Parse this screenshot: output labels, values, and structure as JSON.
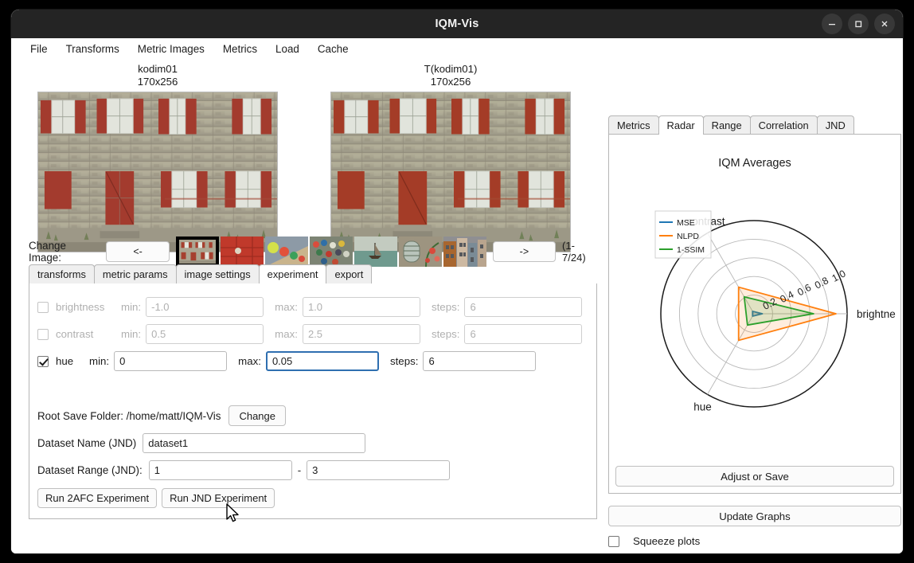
{
  "window": {
    "title": "IQM-Vis",
    "controls": [
      {
        "name": "minimize",
        "glyph": "minimize-icon"
      },
      {
        "name": "maximize",
        "glyph": "maximize-icon"
      },
      {
        "name": "close",
        "glyph": "close-icon"
      }
    ]
  },
  "menubar": {
    "items": [
      "File",
      "Transforms",
      "Metric Images",
      "Metrics",
      "Load",
      "Cache"
    ]
  },
  "images": {
    "source": {
      "name": "kodim01",
      "size": "170x256"
    },
    "transformed": {
      "name": "T(kodim01)",
      "size": "170x256"
    }
  },
  "change_image": {
    "label": "Change Image:",
    "prev_label": "<-",
    "next_label": "->",
    "page_count": "(1-7/24)",
    "thumbs": [
      {
        "name": "kodim01-stone-building",
        "selected": true
      },
      {
        "name": "kodim02-red-door",
        "selected": false
      },
      {
        "name": "kodim03-parasols",
        "selected": false
      },
      {
        "name": "kodim04-cyclists",
        "selected": false
      },
      {
        "name": "kodim05-sailboat",
        "selected": false
      },
      {
        "name": "kodim06-window-flowers",
        "selected": false
      },
      {
        "name": "kodim07-buildings",
        "selected": false
      }
    ]
  },
  "left_tabs": {
    "items": [
      "transforms",
      "metric params",
      "image settings",
      "experiment",
      "export"
    ],
    "active": "experiment"
  },
  "experiment": {
    "rows": [
      {
        "name": "brightness",
        "label": "brightness",
        "checked": false,
        "enabled": false,
        "min_label": "min:",
        "min_value": "-1.0",
        "max_label": "max:",
        "max_value": "1.0",
        "steps_label": "steps:",
        "steps_value": "6",
        "focused_field": ""
      },
      {
        "name": "contrast",
        "label": "contrast",
        "checked": false,
        "enabled": false,
        "min_label": "min:",
        "min_value": "0.5",
        "max_label": "max:",
        "max_value": "2.5",
        "steps_label": "steps:",
        "steps_value": "6",
        "focused_field": ""
      },
      {
        "name": "hue",
        "label": "hue",
        "checked": true,
        "enabled": true,
        "min_label": "min:",
        "min_value": "0",
        "max_label": "max:",
        "max_value": "0.05",
        "steps_label": "steps:",
        "steps_value": "6",
        "focused_field": "max"
      }
    ],
    "root_save_folder_label": "Root Save Folder: /home/matt/IQM-Vis",
    "change_button": "Change",
    "dataset_name_label": "Dataset Name (JND)",
    "dataset_name_value": "dataset1",
    "dataset_range_label": "Dataset Range (JND):",
    "dataset_range_low": "1",
    "dataset_range_dash": "-",
    "dataset_range_high": "3",
    "run_2afc_label": "Run 2AFC Experiment",
    "run_jnd_label": "Run JND Experiment"
  },
  "right_tabs": {
    "items": [
      "Metrics",
      "Radar",
      "Range",
      "Correlation",
      "JND"
    ],
    "active": "Radar"
  },
  "right_panel": {
    "adjust_or_save_label": "Adjust or Save",
    "update_graphs_label": "Update Graphs",
    "squeeze_plots_label": "Squeeze plots",
    "squeeze_checked": false
  },
  "chart_data": {
    "type": "radar",
    "title": "IQM Averages",
    "categories": [
      "brightness",
      "contrast",
      "hue"
    ],
    "category_display": [
      "brightne",
      "contrast",
      "hue"
    ],
    "axis_angles_deg": [
      0,
      120,
      240
    ],
    "rlim": [
      0,
      1.0
    ],
    "rticks": [
      0.2,
      0.4,
      0.6,
      0.8,
      1.0
    ],
    "rtick_labels": [
      "0.2",
      "0.4",
      "0.6",
      "0.8",
      "1.0"
    ],
    "grid": true,
    "legend_position": "upper-left",
    "series": [
      {
        "name": "MSE",
        "color": "#1f77b4",
        "values": [
          0.09,
          0.03,
          0.03
        ]
      },
      {
        "name": "NLPD",
        "color": "#ff7f0e",
        "values": [
          0.88,
          0.33,
          0.33
        ]
      },
      {
        "name": "1-SSIM",
        "color": "#2ca02c",
        "values": [
          0.64,
          0.21,
          0.14
        ]
      }
    ]
  }
}
